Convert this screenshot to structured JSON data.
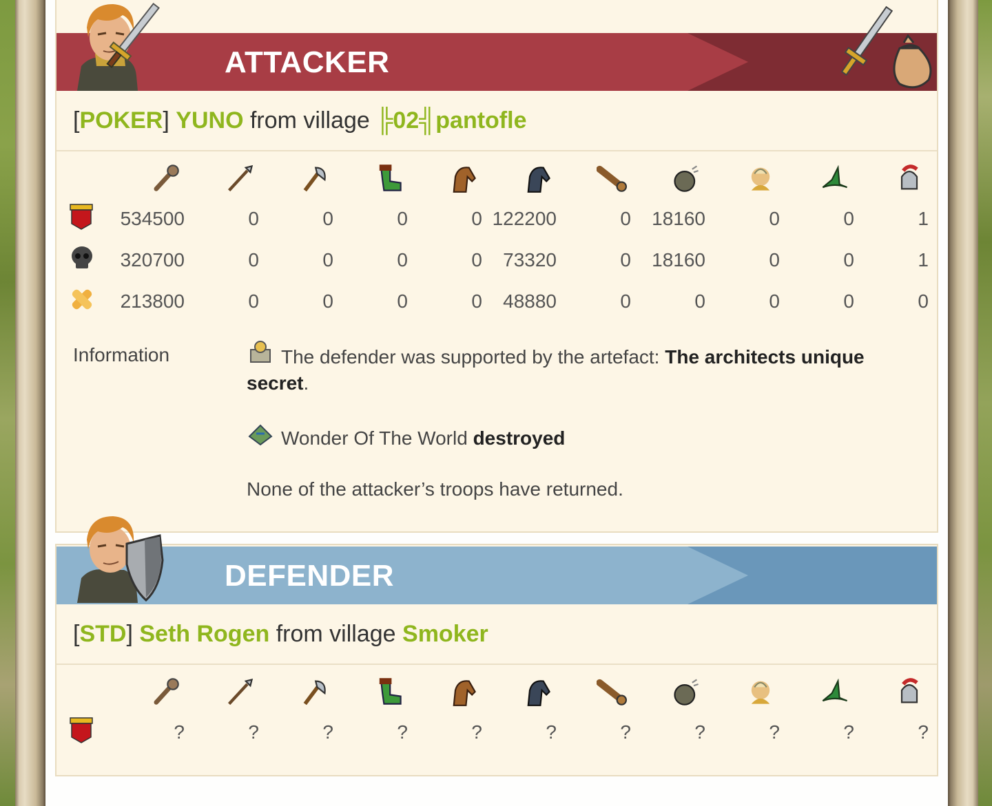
{
  "attacker": {
    "title": "ATTACKER",
    "alliance": "POKER",
    "player": "YUNO",
    "from_text": "from village",
    "village": "╠02╣pantofle",
    "rows": [
      {
        "icon": "troops-sent-icon",
        "values": [
          "534500",
          "0",
          "0",
          "0",
          "0",
          "122200",
          "0",
          "18160",
          "0",
          "0",
          "1"
        ]
      },
      {
        "icon": "skull-icon",
        "values": [
          "320700",
          "0",
          "0",
          "0",
          "0",
          "73320",
          "0",
          "18160",
          "0",
          "0",
          "1"
        ]
      },
      {
        "icon": "bandage-icon",
        "values": [
          "213800",
          "0",
          "0",
          "0",
          "0",
          "48880",
          "0",
          "0",
          "0",
          "0",
          "0"
        ]
      }
    ],
    "info_label": "Information",
    "info_artefact_text": "The defender was supported by the artefact: ",
    "info_artefact_name": "The architects unique secret",
    "info_artefact_end": ".",
    "info_wonder_text": "Wonder Of The World ",
    "info_wonder_status": "destroyed",
    "info_returned": "None of the attacker’s troops have returned."
  },
  "defender": {
    "title": "DEFENDER",
    "alliance": "STD",
    "player": "Seth Rogen",
    "from_text": "from village",
    "village": "Smoker",
    "rows": [
      {
        "icon": "troops-sent-icon",
        "values": [
          "?",
          "?",
          "?",
          "?",
          "?",
          "?",
          "?",
          "?",
          "?",
          "?",
          "?"
        ]
      }
    ]
  },
  "unit_icons": [
    "club-icon",
    "spear-icon",
    "axe-icon",
    "scout-boot-icon",
    "horse-icon",
    "dark-horse-icon",
    "ram-icon",
    "catapult-icon",
    "chief-icon",
    "settler-hat-icon",
    "hero-helmet-icon"
  ],
  "colors": {
    "attacker_banner": "#a83d45",
    "defender_banner": "#8db3cd",
    "link_green": "#8fb61e"
  }
}
